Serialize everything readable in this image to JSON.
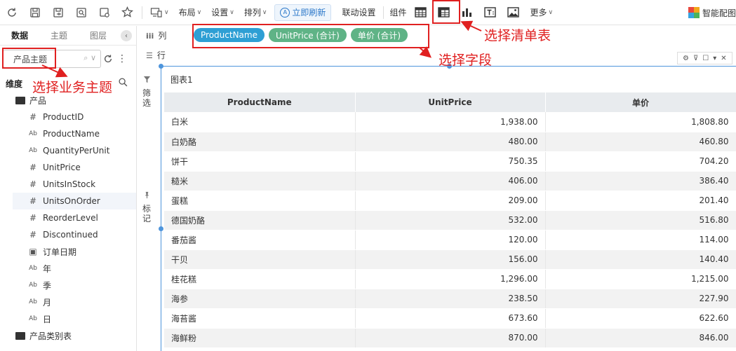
{
  "toolbar": {
    "layout": "布局",
    "settings": "设置",
    "arrange": "排列",
    "refresh": "立即刷新",
    "linkage": "联动设置",
    "component": "组件",
    "more": "更多",
    "smart": "智能配图"
  },
  "left_panel": {
    "tabs": [
      "数据",
      "主题",
      "图层"
    ],
    "subject": "产品主题",
    "dimension_title": "维度",
    "folder_product": "产品",
    "fields": [
      {
        "type": "#",
        "label": "ProductID"
      },
      {
        "type": "Ab",
        "label": "ProductName"
      },
      {
        "type": "Ab",
        "label": "QuantityPerUnit"
      },
      {
        "type": "#",
        "label": "UnitPrice"
      },
      {
        "type": "#",
        "label": "UnitsInStock"
      },
      {
        "type": "#",
        "label": "UnitsOnOrder"
      },
      {
        "type": "#",
        "label": "ReorderLevel"
      },
      {
        "type": "#",
        "label": "Discontinued"
      },
      {
        "type": "date",
        "label": "订单日期"
      },
      {
        "type": "Ab",
        "label": "年"
      },
      {
        "type": "Ab",
        "label": "季"
      },
      {
        "type": "Ab",
        "label": "月"
      },
      {
        "type": "Ab",
        "label": "日"
      }
    ],
    "folder_category": "产品类别表"
  },
  "strip": {
    "filter": "筛选",
    "mark": "标记"
  },
  "fields_area": {
    "columns_label": "列",
    "rows_label": "行",
    "pills": [
      {
        "label": "ProductName",
        "kind": "dim"
      },
      {
        "label": "UnitPrice (合计)",
        "kind": "meas"
      },
      {
        "label": "单价 (合计)",
        "kind": "meas"
      }
    ]
  },
  "chart": {
    "title": "图表1",
    "headers": [
      "ProductName",
      "UnitPrice",
      "单价"
    ],
    "rows": [
      [
        "白米",
        "1,938.00",
        "1,808.80"
      ],
      [
        "白奶酪",
        "480.00",
        "460.80"
      ],
      [
        "饼干",
        "750.35",
        "704.20"
      ],
      [
        "糙米",
        "406.00",
        "386.40"
      ],
      [
        "蛋糕",
        "209.00",
        "201.40"
      ],
      [
        "德国奶酪",
        "532.00",
        "516.80"
      ],
      [
        "番茄酱",
        "120.00",
        "114.00"
      ],
      [
        "干贝",
        "156.00",
        "140.40"
      ],
      [
        "桂花糕",
        "1,296.00",
        "1,215.00"
      ],
      [
        "海参",
        "238.50",
        "227.90"
      ],
      [
        "海苔酱",
        "673.60",
        "622.60"
      ],
      [
        "海鲜粉",
        "870.00",
        "846.00"
      ]
    ]
  },
  "annotations": {
    "select_table": "选择清单表",
    "select_fields": "选择字段",
    "select_subject": "选择业务主题"
  },
  "colors": {
    "accent": "#2e9fd4",
    "measure": "#5fb386",
    "annotation": "#e02020"
  }
}
